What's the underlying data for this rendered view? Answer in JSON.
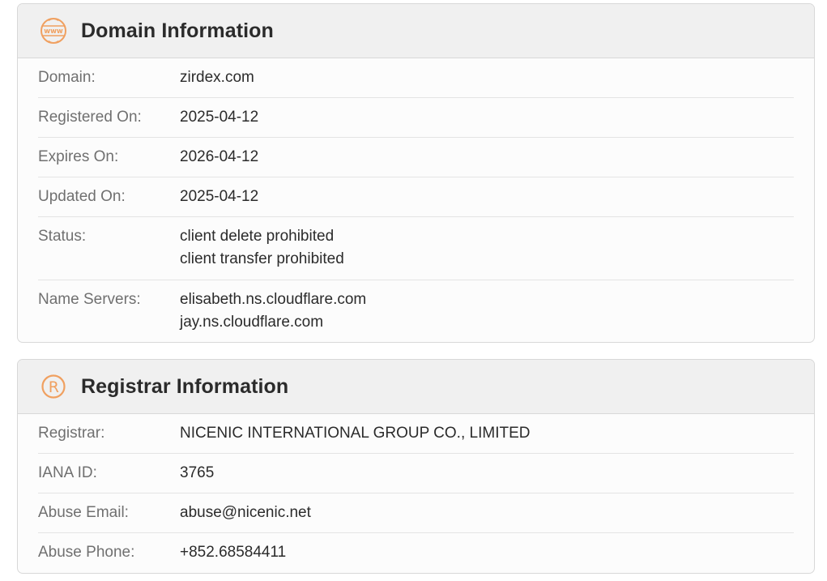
{
  "domain_section": {
    "title": "Domain Information",
    "icon": "www-globe-icon",
    "rows": [
      {
        "label": "Domain:",
        "values": [
          "zirdex.com"
        ]
      },
      {
        "label": "Registered On:",
        "values": [
          "2025-04-12"
        ]
      },
      {
        "label": "Expires On:",
        "values": [
          "2026-04-12"
        ]
      },
      {
        "label": "Updated On:",
        "values": [
          "2025-04-12"
        ]
      },
      {
        "label": "Status:",
        "values": [
          "client delete prohibited",
          "client transfer prohibited"
        ]
      },
      {
        "label": "Name Servers:",
        "values": [
          "elisabeth.ns.cloudflare.com",
          "jay.ns.cloudflare.com"
        ]
      }
    ]
  },
  "registrar_section": {
    "title": "Registrar Information",
    "icon": "registered-trademark-icon",
    "rows": [
      {
        "label": "Registrar:",
        "values": [
          "NICENIC INTERNATIONAL GROUP CO., LIMITED"
        ]
      },
      {
        "label": "IANA ID:",
        "values": [
          "3765"
        ]
      },
      {
        "label": "Abuse Email:",
        "values": [
          "abuse@nicenic.net"
        ]
      },
      {
        "label": "Abuse Phone:",
        "values": [
          "+852.68584411"
        ]
      }
    ]
  },
  "colors": {
    "accent": "#f0a060",
    "label": "#707070",
    "value": "#2b2b2b",
    "header_bg": "#f0f0f0"
  }
}
